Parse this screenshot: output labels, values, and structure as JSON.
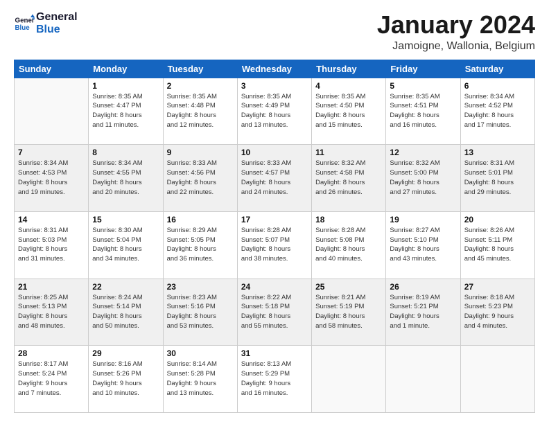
{
  "logo": {
    "line1": "General",
    "line2": "Blue"
  },
  "title": "January 2024",
  "subtitle": "Jamoigne, Wallonia, Belgium",
  "weekdays": [
    "Sunday",
    "Monday",
    "Tuesday",
    "Wednesday",
    "Thursday",
    "Friday",
    "Saturday"
  ],
  "weeks": [
    {
      "shaded": false,
      "days": [
        {
          "num": "",
          "info": ""
        },
        {
          "num": "1",
          "info": "Sunrise: 8:35 AM\nSunset: 4:47 PM\nDaylight: 8 hours\nand 11 minutes."
        },
        {
          "num": "2",
          "info": "Sunrise: 8:35 AM\nSunset: 4:48 PM\nDaylight: 8 hours\nand 12 minutes."
        },
        {
          "num": "3",
          "info": "Sunrise: 8:35 AM\nSunset: 4:49 PM\nDaylight: 8 hours\nand 13 minutes."
        },
        {
          "num": "4",
          "info": "Sunrise: 8:35 AM\nSunset: 4:50 PM\nDaylight: 8 hours\nand 15 minutes."
        },
        {
          "num": "5",
          "info": "Sunrise: 8:35 AM\nSunset: 4:51 PM\nDaylight: 8 hours\nand 16 minutes."
        },
        {
          "num": "6",
          "info": "Sunrise: 8:34 AM\nSunset: 4:52 PM\nDaylight: 8 hours\nand 17 minutes."
        }
      ]
    },
    {
      "shaded": true,
      "days": [
        {
          "num": "7",
          "info": "Sunrise: 8:34 AM\nSunset: 4:53 PM\nDaylight: 8 hours\nand 19 minutes."
        },
        {
          "num": "8",
          "info": "Sunrise: 8:34 AM\nSunset: 4:55 PM\nDaylight: 8 hours\nand 20 minutes."
        },
        {
          "num": "9",
          "info": "Sunrise: 8:33 AM\nSunset: 4:56 PM\nDaylight: 8 hours\nand 22 minutes."
        },
        {
          "num": "10",
          "info": "Sunrise: 8:33 AM\nSunset: 4:57 PM\nDaylight: 8 hours\nand 24 minutes."
        },
        {
          "num": "11",
          "info": "Sunrise: 8:32 AM\nSunset: 4:58 PM\nDaylight: 8 hours\nand 26 minutes."
        },
        {
          "num": "12",
          "info": "Sunrise: 8:32 AM\nSunset: 5:00 PM\nDaylight: 8 hours\nand 27 minutes."
        },
        {
          "num": "13",
          "info": "Sunrise: 8:31 AM\nSunset: 5:01 PM\nDaylight: 8 hours\nand 29 minutes."
        }
      ]
    },
    {
      "shaded": false,
      "days": [
        {
          "num": "14",
          "info": "Sunrise: 8:31 AM\nSunset: 5:03 PM\nDaylight: 8 hours\nand 31 minutes."
        },
        {
          "num": "15",
          "info": "Sunrise: 8:30 AM\nSunset: 5:04 PM\nDaylight: 8 hours\nand 34 minutes."
        },
        {
          "num": "16",
          "info": "Sunrise: 8:29 AM\nSunset: 5:05 PM\nDaylight: 8 hours\nand 36 minutes."
        },
        {
          "num": "17",
          "info": "Sunrise: 8:28 AM\nSunset: 5:07 PM\nDaylight: 8 hours\nand 38 minutes."
        },
        {
          "num": "18",
          "info": "Sunrise: 8:28 AM\nSunset: 5:08 PM\nDaylight: 8 hours\nand 40 minutes."
        },
        {
          "num": "19",
          "info": "Sunrise: 8:27 AM\nSunset: 5:10 PM\nDaylight: 8 hours\nand 43 minutes."
        },
        {
          "num": "20",
          "info": "Sunrise: 8:26 AM\nSunset: 5:11 PM\nDaylight: 8 hours\nand 45 minutes."
        }
      ]
    },
    {
      "shaded": true,
      "days": [
        {
          "num": "21",
          "info": "Sunrise: 8:25 AM\nSunset: 5:13 PM\nDaylight: 8 hours\nand 48 minutes."
        },
        {
          "num": "22",
          "info": "Sunrise: 8:24 AM\nSunset: 5:14 PM\nDaylight: 8 hours\nand 50 minutes."
        },
        {
          "num": "23",
          "info": "Sunrise: 8:23 AM\nSunset: 5:16 PM\nDaylight: 8 hours\nand 53 minutes."
        },
        {
          "num": "24",
          "info": "Sunrise: 8:22 AM\nSunset: 5:18 PM\nDaylight: 8 hours\nand 55 minutes."
        },
        {
          "num": "25",
          "info": "Sunrise: 8:21 AM\nSunset: 5:19 PM\nDaylight: 8 hours\nand 58 minutes."
        },
        {
          "num": "26",
          "info": "Sunrise: 8:19 AM\nSunset: 5:21 PM\nDaylight: 9 hours\nand 1 minute."
        },
        {
          "num": "27",
          "info": "Sunrise: 8:18 AM\nSunset: 5:23 PM\nDaylight: 9 hours\nand 4 minutes."
        }
      ]
    },
    {
      "shaded": false,
      "days": [
        {
          "num": "28",
          "info": "Sunrise: 8:17 AM\nSunset: 5:24 PM\nDaylight: 9 hours\nand 7 minutes."
        },
        {
          "num": "29",
          "info": "Sunrise: 8:16 AM\nSunset: 5:26 PM\nDaylight: 9 hours\nand 10 minutes."
        },
        {
          "num": "30",
          "info": "Sunrise: 8:14 AM\nSunset: 5:28 PM\nDaylight: 9 hours\nand 13 minutes."
        },
        {
          "num": "31",
          "info": "Sunrise: 8:13 AM\nSunset: 5:29 PM\nDaylight: 9 hours\nand 16 minutes."
        },
        {
          "num": "",
          "info": ""
        },
        {
          "num": "",
          "info": ""
        },
        {
          "num": "",
          "info": ""
        }
      ]
    }
  ]
}
